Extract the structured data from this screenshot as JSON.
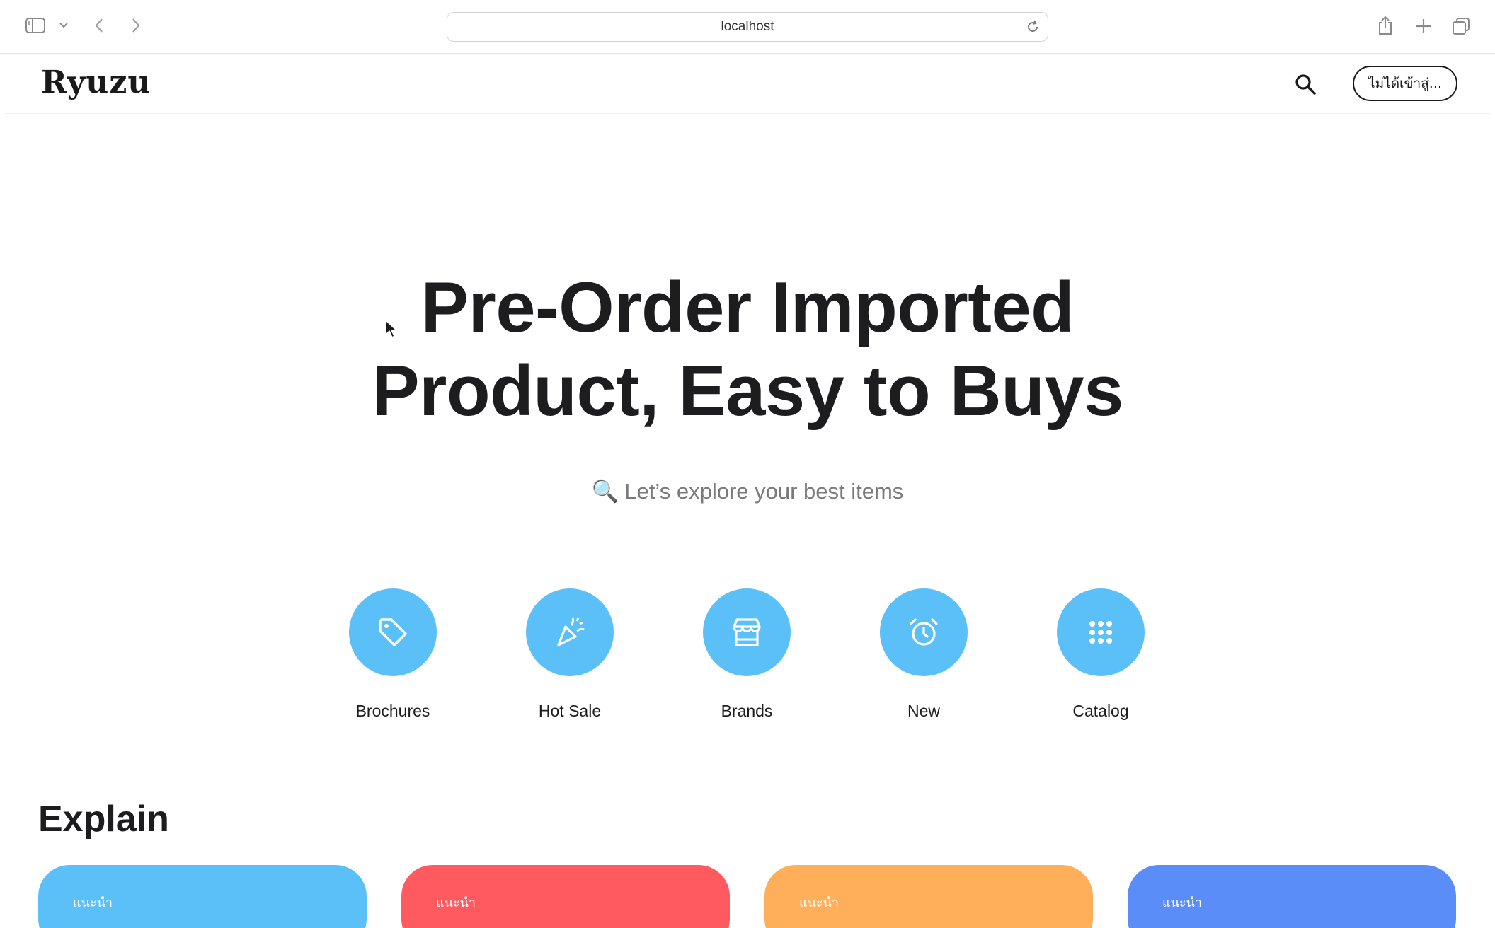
{
  "browser": {
    "url": "localhost"
  },
  "header": {
    "logo": "Ryuzu",
    "login_label": "ไม่ได้เข้าสู่..."
  },
  "hero": {
    "title_line1": "Pre-Order Imported",
    "title_line2": "Product, Easy to Buys",
    "subtitle_icon": "🔍",
    "subtitle": "Let’s explore your best items"
  },
  "categories": [
    {
      "label": "Brochures",
      "icon": "tag-icon"
    },
    {
      "label": "Hot Sale",
      "icon": "party-popper-icon"
    },
    {
      "label": "Brands",
      "icon": "store-icon"
    },
    {
      "label": "New",
      "icon": "alarm-clock-icon"
    },
    {
      "label": "Catalog",
      "icon": "grid-dots-icon"
    }
  ],
  "explain": {
    "title": "Explain",
    "cards": [
      {
        "tag": "แนะนำ",
        "title": "",
        "color": "#5bc0f8"
      },
      {
        "tag": "แนะนำ",
        "title": "",
        "color": "#ff5a5f"
      },
      {
        "tag": "แนะนำ",
        "title": "",
        "color": "#ffae5a"
      },
      {
        "tag": "แนะนำ",
        "title": "",
        "color": "#5b8df8"
      }
    ]
  },
  "colors": {
    "accent": "#5bc0f8",
    "text": "#1d1d1f",
    "muted": "#7a7a7a"
  }
}
